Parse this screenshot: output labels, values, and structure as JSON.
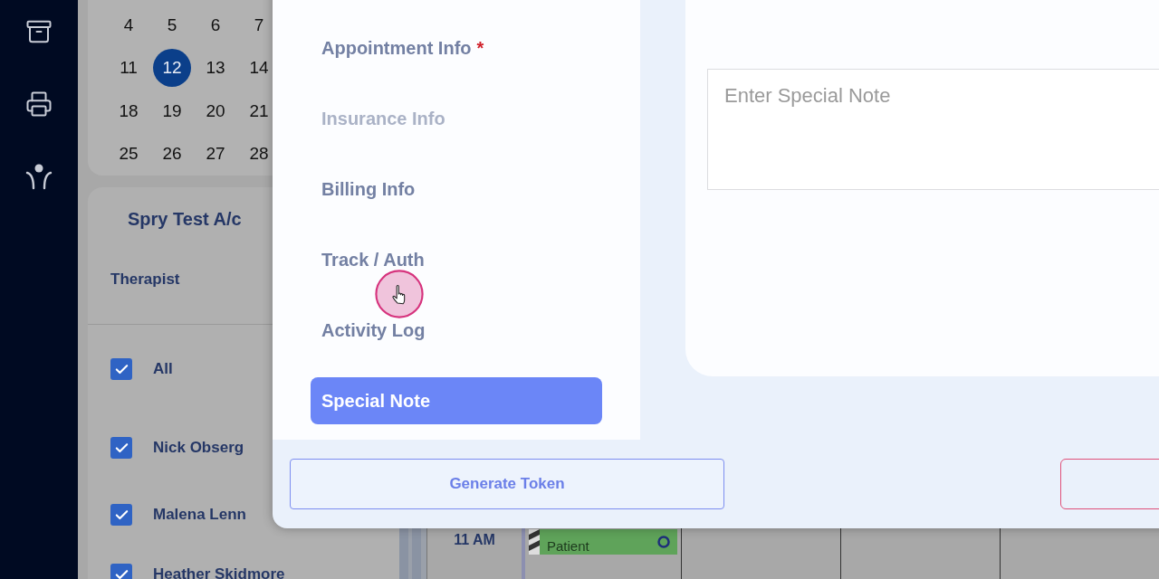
{
  "calendar": {
    "weeks": [
      [
        {
          "day": "4",
          "selected": false
        },
        {
          "day": "5",
          "selected": false
        },
        {
          "day": "6",
          "selected": false
        },
        {
          "day": "7",
          "selected": false
        }
      ],
      [
        {
          "day": "11",
          "selected": false
        },
        {
          "day": "12",
          "selected": true
        },
        {
          "day": "13",
          "selected": false
        },
        {
          "day": "14",
          "selected": false
        }
      ],
      [
        {
          "day": "18",
          "selected": false
        },
        {
          "day": "19",
          "selected": false
        },
        {
          "day": "20",
          "selected": false
        },
        {
          "day": "21",
          "selected": false
        }
      ],
      [
        {
          "day": "25",
          "selected": false
        },
        {
          "day": "26",
          "selected": false
        },
        {
          "day": "27",
          "selected": false
        },
        {
          "day": "28",
          "selected": false
        }
      ]
    ]
  },
  "filter_panel": {
    "title": "Spry Test A/c",
    "section_label": "Therapist",
    "therapists": [
      {
        "name": "All",
        "checked": true
      },
      {
        "name": "Nick Obserg",
        "checked": true
      },
      {
        "name": "Malena Lenn",
        "checked": true
      },
      {
        "name": "Heather Skidmore",
        "checked": true
      }
    ]
  },
  "schedule": {
    "time_label": "11 AM",
    "event": {
      "label": "Patient",
      "color": "#5fa35a"
    }
  },
  "modal": {
    "nav_items": [
      {
        "label": "Appointment Info",
        "required_mark": "*",
        "selected": false,
        "disabled": false
      },
      {
        "label": "Insurance Info",
        "selected": false,
        "disabled": true
      },
      {
        "label": "Billing Info",
        "selected": false,
        "disabled": false
      },
      {
        "label": "Track / Auth",
        "selected": false,
        "disabled": false
      },
      {
        "label": "Activity Log",
        "selected": false,
        "disabled": false
      },
      {
        "label": "Special Note",
        "selected": true,
        "disabled": false
      }
    ],
    "note_field": {
      "placeholder": "Enter Special Note"
    },
    "footer": {
      "generate_button": "Generate Token"
    }
  }
}
